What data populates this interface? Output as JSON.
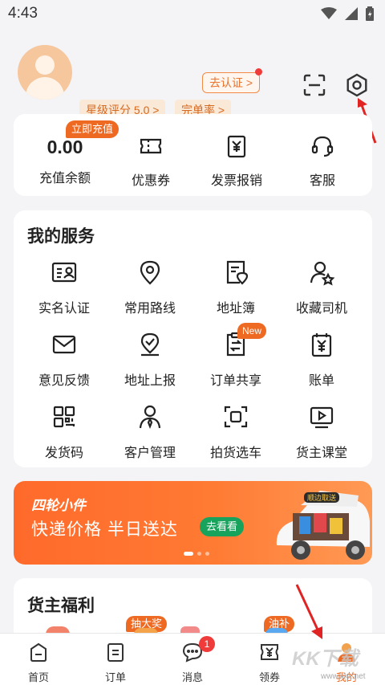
{
  "status_bar": {
    "time": "4:43",
    "icons": [
      "wifi-icon",
      "signal-icon",
      "battery-icon"
    ]
  },
  "header": {
    "verify_label": "去认证 >",
    "rating_label": "星级评分 5.0 >",
    "completion_label": "完单率 >",
    "scan_icon": "scan-icon",
    "settings_icon": "settings-hexagon-icon"
  },
  "wallet": {
    "balance_value": "0.00",
    "recharge_badge": "立即充值",
    "items": [
      {
        "label": "充值余额"
      },
      {
        "label": "优惠券",
        "icon": "ticket-icon"
      },
      {
        "label": "发票报销",
        "icon": "invoice-icon"
      },
      {
        "label": "客服",
        "icon": "headset-icon"
      }
    ]
  },
  "services": {
    "title": "我的服务",
    "new_badge": "New",
    "items": [
      {
        "label": "实名认证",
        "icon": "id-card-icon"
      },
      {
        "label": "常用路线",
        "icon": "location-pin-icon"
      },
      {
        "label": "地址簿",
        "icon": "address-book-icon"
      },
      {
        "label": "收藏司机",
        "icon": "favorite-driver-icon"
      },
      {
        "label": "意见反馈",
        "icon": "mail-icon"
      },
      {
        "label": "地址上报",
        "icon": "location-check-icon"
      },
      {
        "label": "订单共享",
        "icon": "order-share-icon"
      },
      {
        "label": "账单",
        "icon": "bill-icon"
      },
      {
        "label": "发货码",
        "icon": "qr-code-icon"
      },
      {
        "label": "客户管理",
        "icon": "customer-icon"
      },
      {
        "label": "拍货选车",
        "icon": "camera-scan-icon"
      },
      {
        "label": "货主课堂",
        "icon": "video-icon"
      }
    ]
  },
  "banner": {
    "brand": "四轮小件",
    "slogan": "快递价格 半日送达",
    "cta": "去看看",
    "car_sign": "顺边取送"
  },
  "welfare": {
    "title": "货主福利",
    "badges": [
      "抽大奖",
      "油补"
    ]
  },
  "tabbar": {
    "tabs": [
      {
        "label": "首页",
        "icon": "home-icon"
      },
      {
        "label": "订单",
        "icon": "order-icon"
      },
      {
        "label": "消息",
        "icon": "message-icon"
      },
      {
        "label": "领券",
        "icon": "coupon-icon"
      },
      {
        "label": "我的",
        "icon": "profile-icon"
      }
    ],
    "message_badge": "1",
    "active_tab": "我的"
  },
  "watermark": {
    "text": "KK下载",
    "url": "www.kkx.net"
  },
  "colors": {
    "accent": "#ee6a23",
    "badge_red": "#f03b3b",
    "banner": "#ff6a2b",
    "cta_green": "#18a35c"
  }
}
